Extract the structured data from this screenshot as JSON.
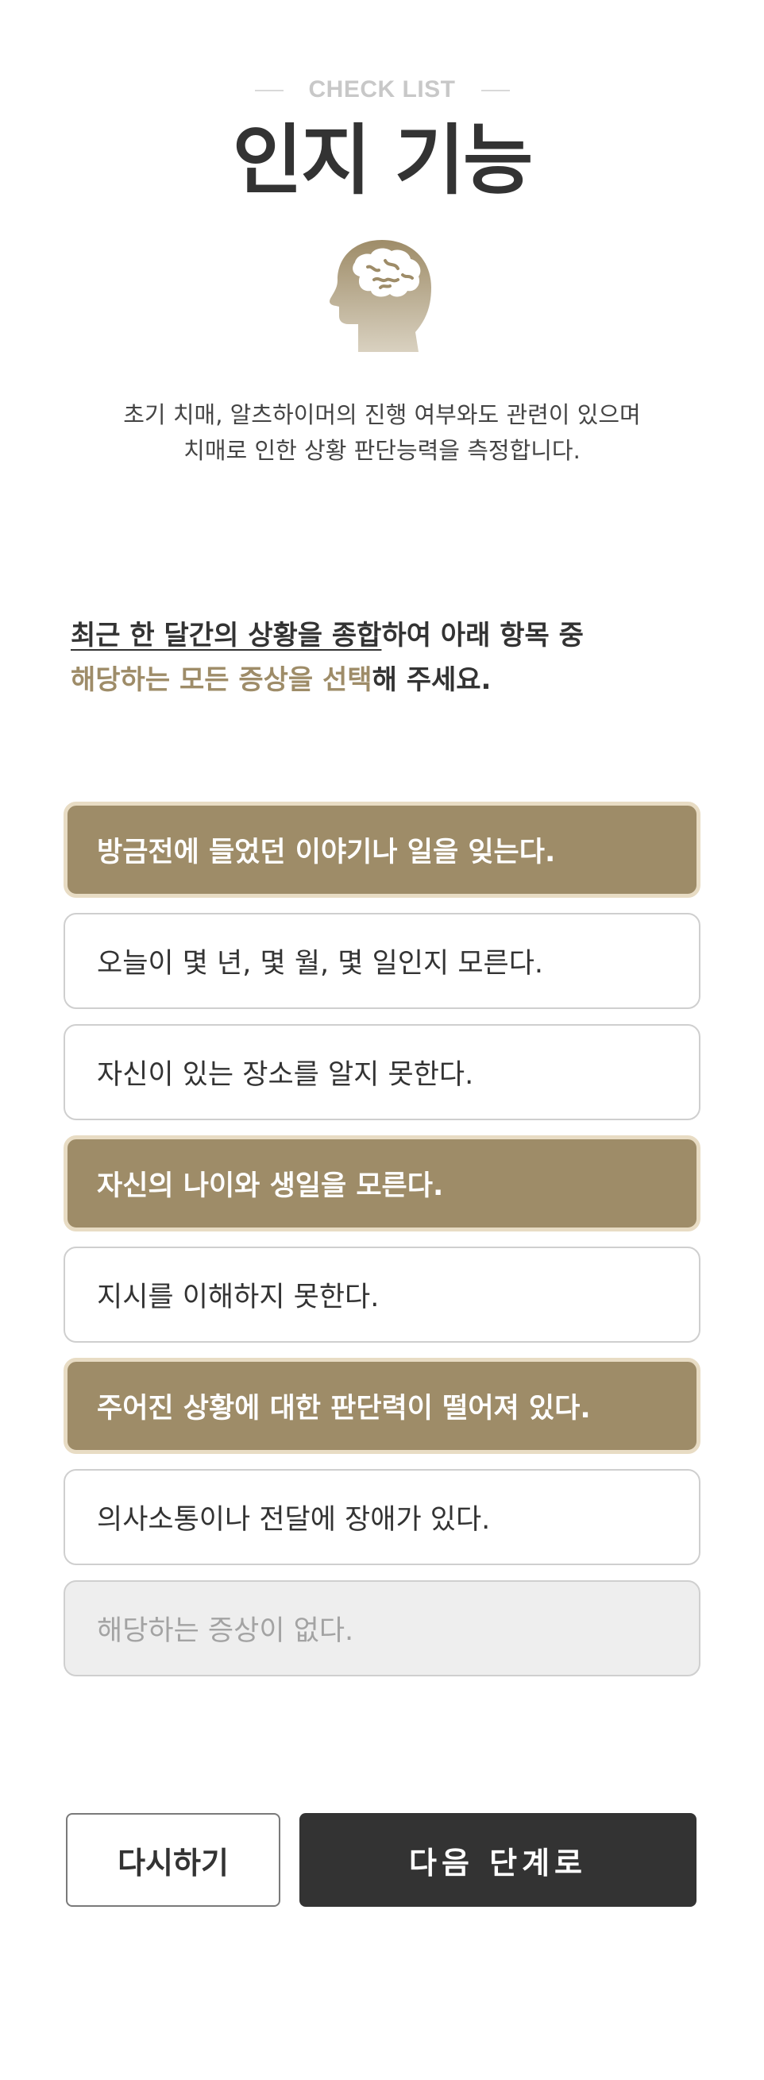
{
  "header": {
    "eyebrow": "CHECK LIST",
    "title": "인지 기능",
    "icon": "brain-head-icon"
  },
  "description": {
    "line1": "초기 치매, 알츠하이머의 진행 여부와도 관련이 있으며",
    "line2": "치매로 인한 상황 판단능력을 측정합니다."
  },
  "instruction": {
    "part1_underlined": "최근 한 달간의 상황을 종합",
    "part2": "하여 아래 항목 중",
    "part3_accent": "해당하는 모든 증상을 선택",
    "part4": "해 주세요."
  },
  "options": [
    {
      "label": "방금전에 들었던 이야기나 일을 잊는다.",
      "selected": true
    },
    {
      "label": "오늘이 몇 년, 몇 월, 몇 일인지 모른다.",
      "selected": false
    },
    {
      "label": "자신이 있는 장소를 알지 못한다.",
      "selected": false
    },
    {
      "label": "자신의 나이와 생일을 모른다.",
      "selected": true
    },
    {
      "label": "지시를 이해하지 못한다.",
      "selected": false
    },
    {
      "label": "주어진 상황에 대한 판단력이 떨어져 있다.",
      "selected": true
    },
    {
      "label": "의사소통이나 전달에 장애가 있다.",
      "selected": false
    },
    {
      "label": "해당하는 증상이 없다.",
      "selected": false
    }
  ],
  "buttons": {
    "retry": "다시하기",
    "next": "다음 단계로"
  },
  "colors": {
    "accent": "#9e8c68",
    "accent_border": "#e8dcc4",
    "dark": "#333333",
    "muted": "#c8c8c8"
  }
}
